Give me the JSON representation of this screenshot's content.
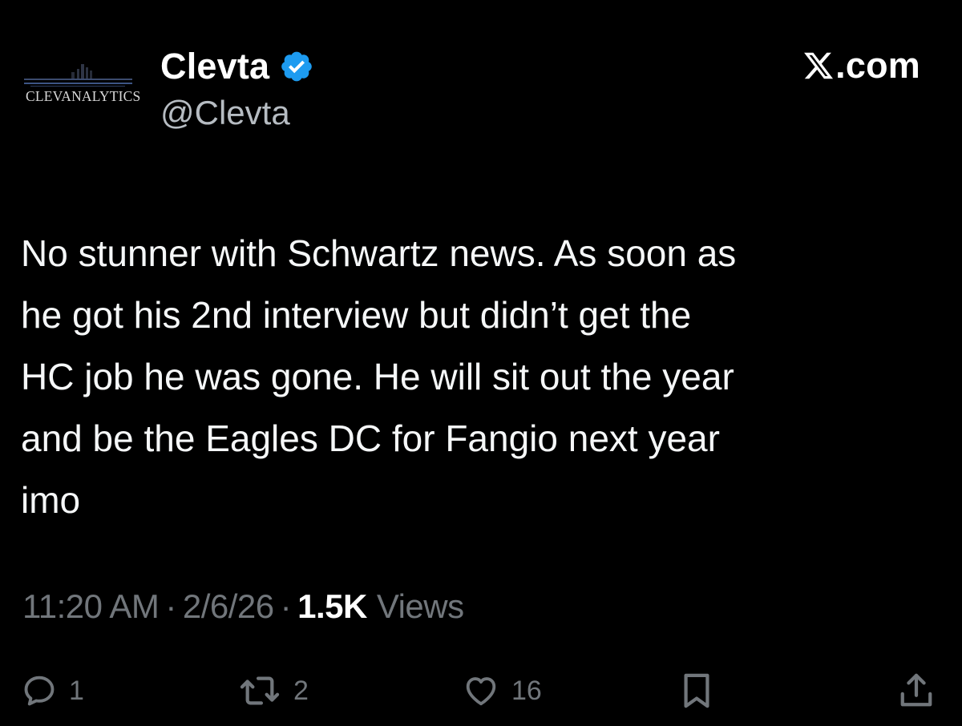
{
  "author": {
    "avatar_text": "CLEVANALYTICS",
    "display_name": "Clevta",
    "handle": "@Clevta",
    "verified": true
  },
  "brand": {
    "text": ".com",
    "icon": "x-logo-icon"
  },
  "tweet": {
    "text": "No stunner with Schwartz news. As soon as\nhe got his 2nd interview but didn’t get the\nHC job he was gone. He will sit out the year\nand be the Eagles DC for Fangio next year\nimo"
  },
  "meta": {
    "time": "11:20 AM",
    "separator": "·",
    "date": "2/6/26",
    "views_count": "1.5K",
    "views_label": "Views"
  },
  "actions": {
    "reply": {
      "icon": "reply-icon",
      "count": "1"
    },
    "repost": {
      "icon": "repost-icon",
      "count": "2"
    },
    "like": {
      "icon": "heart-icon",
      "count": "16"
    },
    "bookmark": {
      "icon": "bookmark-icon"
    },
    "share": {
      "icon": "share-icon"
    }
  },
  "colors": {
    "background": "#000000",
    "text_primary": "#e7e9ea",
    "text_secondary": "#71767b",
    "verified_blue": "#1d9bf0"
  }
}
